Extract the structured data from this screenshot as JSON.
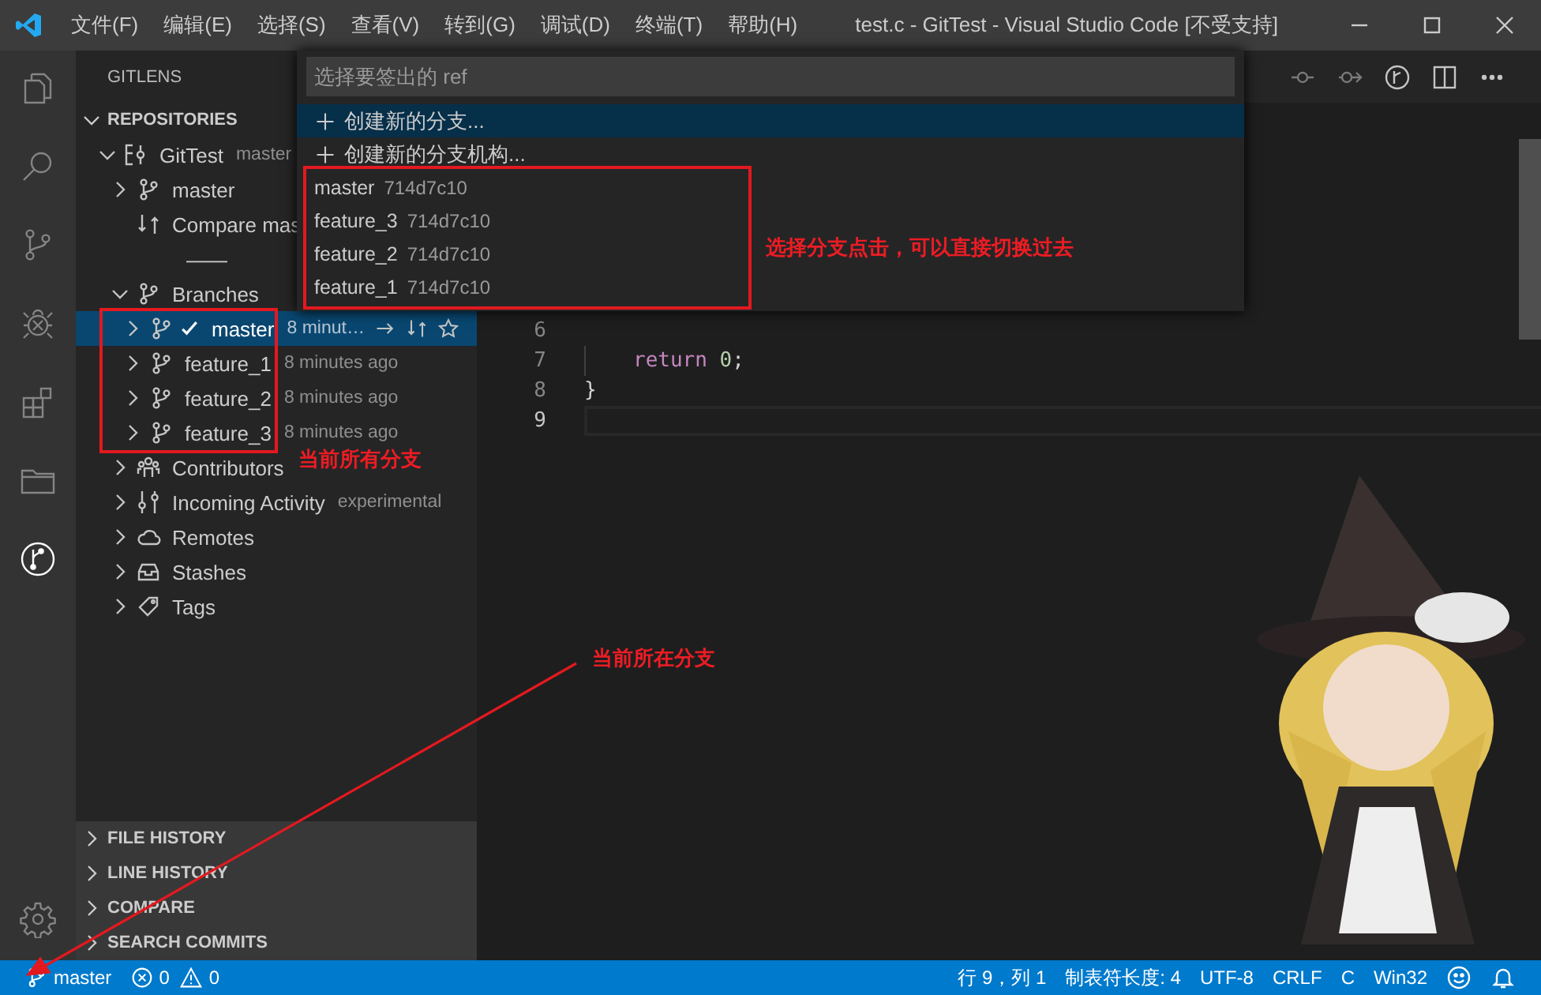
{
  "title_bar": {
    "menu": [
      "文件(F)",
      "编辑(E)",
      "选择(S)",
      "查看(V)",
      "转到(G)",
      "调试(D)",
      "终端(T)",
      "帮助(H)"
    ],
    "title": "test.c - GitTest - Visual Studio Code [不受支持]"
  },
  "activity_bar": {
    "items": [
      {
        "selected": false
      },
      {
        "selected": false
      },
      {
        "selected": false
      },
      {
        "selected": false
      },
      {
        "selected": false
      },
      {
        "selected": false
      },
      {
        "selected": true
      }
    ]
  },
  "sidebar": {
    "title": "GITLENS",
    "section": {
      "title": "REPOSITORIES",
      "expanded": true
    },
    "tree": [
      {
        "kind": "repo",
        "label": "GitTest",
        "description": "master",
        "expanded": true,
        "selected": false,
        "children": [
          {
            "kind": "branch",
            "label": "master",
            "expanded": false,
            "selected": false
          },
          {
            "kind": "compare",
            "label": "Compare mas",
            "selected": false
          },
          {
            "kind": "separator",
            "label": "——",
            "selected": false
          },
          {
            "kind": "branches",
            "label": "Branches",
            "expanded": true,
            "selected": false,
            "callout": {
              "text": "当前所有分支"
            },
            "children": [
              {
                "kind": "branch",
                "label": "master",
                "description": "8 minut…",
                "current": true,
                "expanded": false,
                "selected": true
              },
              {
                "kind": "branch",
                "label": "feature_1",
                "description": "8 minutes ago",
                "current": false,
                "expanded": false,
                "selected": false
              },
              {
                "kind": "branch",
                "label": "feature_2",
                "description": "8 minutes ago",
                "current": false,
                "expanded": false,
                "selected": false
              },
              {
                "kind": "branch",
                "label": "feature_3",
                "description": "8 minutes ago",
                "current": false,
                "expanded": false,
                "selected": false
              }
            ]
          },
          {
            "kind": "contributors",
            "label": "Contributors",
            "expanded": false,
            "selected": false
          },
          {
            "kind": "incoming",
            "label": "Incoming Activity",
            "description": "experimental",
            "expanded": false,
            "selected": false
          },
          {
            "kind": "remotes",
            "label": "Remotes",
            "expanded": false,
            "selected": false
          },
          {
            "kind": "stashes",
            "label": "Stashes",
            "expanded": false,
            "selected": false
          },
          {
            "kind": "tags",
            "label": "Tags",
            "expanded": false,
            "selected": false
          }
        ]
      }
    ],
    "panels": [
      {
        "title": "FILE HISTORY",
        "expanded": false
      },
      {
        "title": "LINE HISTORY",
        "expanded": false
      },
      {
        "title": "COMPARE",
        "expanded": false
      },
      {
        "title": "SEARCH COMMITS",
        "expanded": false
      }
    ]
  },
  "quick_pick": {
    "placeholder": "选择要签出的 ref",
    "callout": {
      "text": "选择分支点击，可以直接切换过去"
    },
    "items": [
      {
        "kind": "action",
        "label": "创建新的分支...",
        "selected": true
      },
      {
        "kind": "action",
        "label": "创建新的分支机构...",
        "selected": false
      },
      {
        "kind": "ref",
        "label": "master",
        "description": "714d7c10",
        "selected": false
      },
      {
        "kind": "ref",
        "label": "feature_3",
        "description": "714d7c10",
        "selected": false
      },
      {
        "kind": "ref",
        "label": "feature_2",
        "description": "714d7c10",
        "selected": false
      },
      {
        "kind": "ref",
        "label": "feature_1",
        "description": "714d7c10",
        "selected": false
      }
    ]
  },
  "editor": {
    "lines": [
      {
        "number": "6",
        "current": false
      },
      {
        "number": "7",
        "current": false,
        "indented": true,
        "tokens": [
          {
            "kind": "keyword",
            "text": "return"
          },
          {
            "kind": "number",
            "text": " 0"
          },
          {
            "kind": "plain",
            "text": ";"
          }
        ]
      },
      {
        "number": "8",
        "current": false,
        "tokens": [
          {
            "kind": "plain",
            "text": "}"
          }
        ]
      },
      {
        "number": "9",
        "current": true
      }
    ]
  },
  "status_bar": {
    "branch": {
      "label": "master",
      "callout": {
        "text": "当前所在分支"
      }
    },
    "errors": "0",
    "warnings": "0",
    "items": [
      "行 9，列 1",
      "制表符长度: 4",
      "UTF-8",
      "CRLF",
      "C",
      "Win32"
    ]
  }
}
